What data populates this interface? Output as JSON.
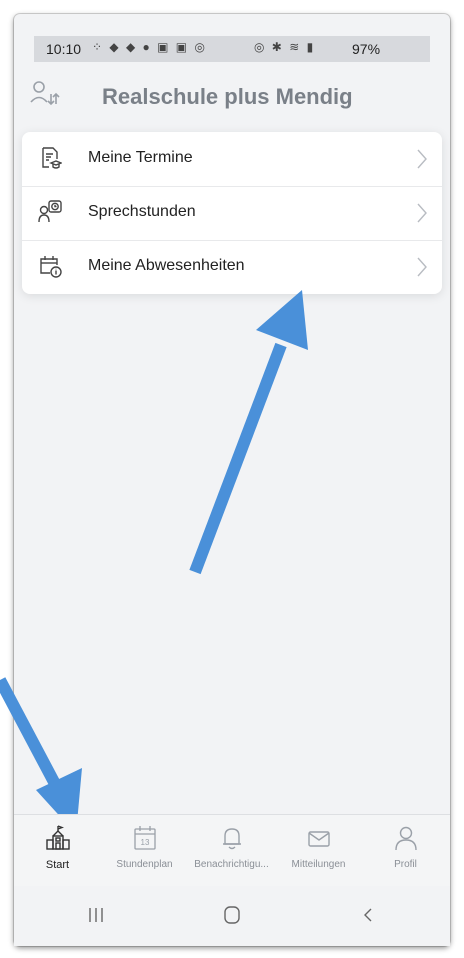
{
  "status_bar": {
    "time": "10:10",
    "battery": "97%",
    "left_icons": [
      "notification-icons"
    ],
    "right_icons": [
      "alarm-icon",
      "bluetooth-icon",
      "wifi-icon",
      "signal-icon"
    ]
  },
  "header": {
    "title": "Realschule plus Mendig",
    "switch_icon": "user-switch-icon"
  },
  "menu": {
    "items": [
      {
        "label": "Meine Termine",
        "icon": "appointments-icon"
      },
      {
        "label": "Sprechstunden",
        "icon": "consultation-icon"
      },
      {
        "label": "Meine Abwesenheiten",
        "icon": "absence-calendar-icon"
      }
    ]
  },
  "annotations": {
    "arrow_color": "#4a90d9"
  },
  "tabbar": {
    "tabs": [
      {
        "label": "Start",
        "icon": "school-building-icon",
        "active": true
      },
      {
        "label": "Stundenplan",
        "icon": "calendar-13-icon",
        "active": false
      },
      {
        "label": "Benachrichtigu...",
        "icon": "bell-icon",
        "active": false
      },
      {
        "label": "Mitteilungen",
        "icon": "envelope-icon",
        "active": false
      },
      {
        "label": "Profil",
        "icon": "person-icon",
        "active": false
      }
    ],
    "calendar_day": "13"
  },
  "navbar": {
    "buttons": [
      "recent-apps-icon",
      "home-icon",
      "back-icon"
    ]
  }
}
